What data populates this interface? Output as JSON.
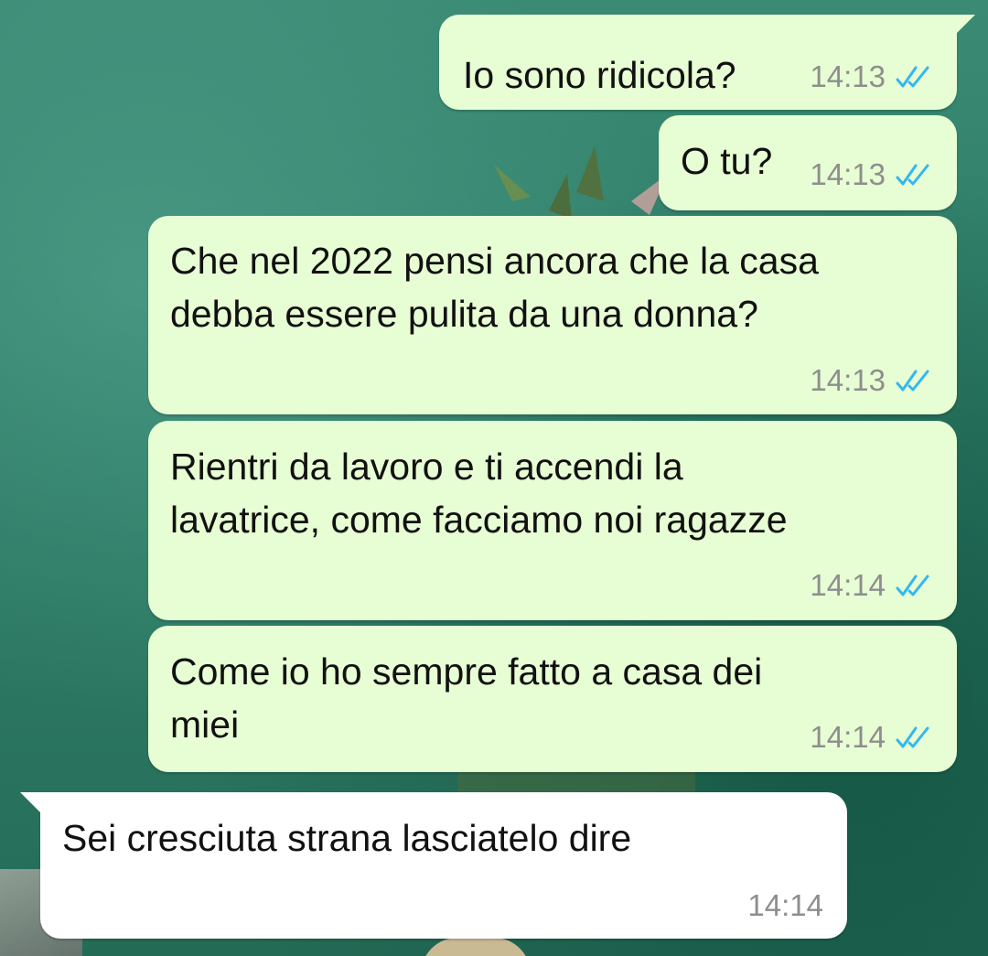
{
  "theme": {
    "outgoing_bubble": "#e7fdd3",
    "incoming_bubble": "#ffffff",
    "read_ticks": "#34b7f1",
    "time_text": "#8e8e8e"
  },
  "messages": [
    {
      "direction": "outgoing",
      "lines": [
        "Io sono ridicola?"
      ],
      "time": "14:13",
      "status_icon": "double-check-read-icon"
    },
    {
      "direction": "outgoing",
      "lines": [
        "O tu?"
      ],
      "time": "14:13",
      "status_icon": "double-check-read-icon"
    },
    {
      "direction": "outgoing",
      "lines": [
        "Che nel 2022 pensi ancora che la casa",
        "debba essere pulita da una donna?"
      ],
      "time": "14:13",
      "status_icon": "double-check-read-icon"
    },
    {
      "direction": "outgoing",
      "lines": [
        "Rientri da lavoro e ti accendi la",
        "lavatrice, come facciamo noi ragazze"
      ],
      "time": "14:14",
      "status_icon": "double-check-read-icon"
    },
    {
      "direction": "outgoing",
      "lines": [
        "Come io ho sempre fatto a casa dei",
        "miei"
      ],
      "time": "14:14",
      "status_icon": "double-check-read-icon"
    },
    {
      "direction": "incoming",
      "lines": [
        "Sei cresciuta strana lasciatelo dire"
      ],
      "time": "14:14"
    }
  ]
}
